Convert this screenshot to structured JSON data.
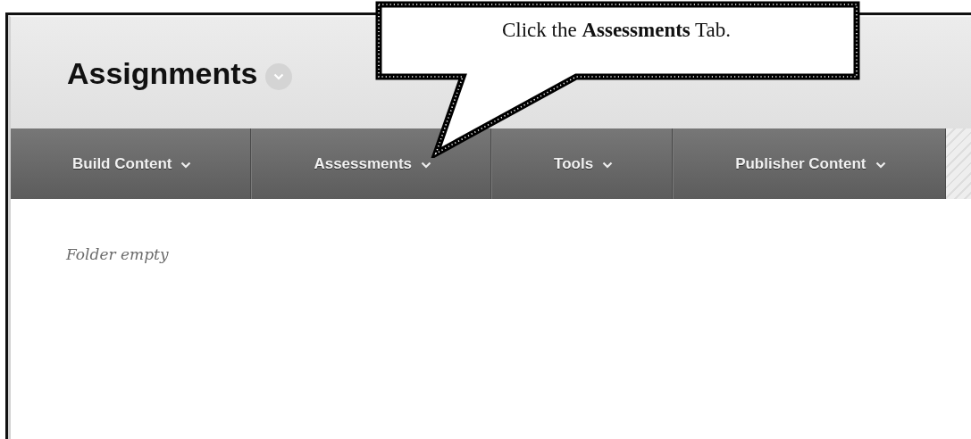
{
  "page": {
    "title": "Assignments"
  },
  "tabs": [
    {
      "label": "Build Content"
    },
    {
      "label": "Assessments"
    },
    {
      "label": "Tools"
    },
    {
      "label": "Publisher Content"
    }
  ],
  "content": {
    "empty_message": "Folder empty"
  },
  "callout": {
    "text": "Click the **Assessments** Tab."
  }
}
